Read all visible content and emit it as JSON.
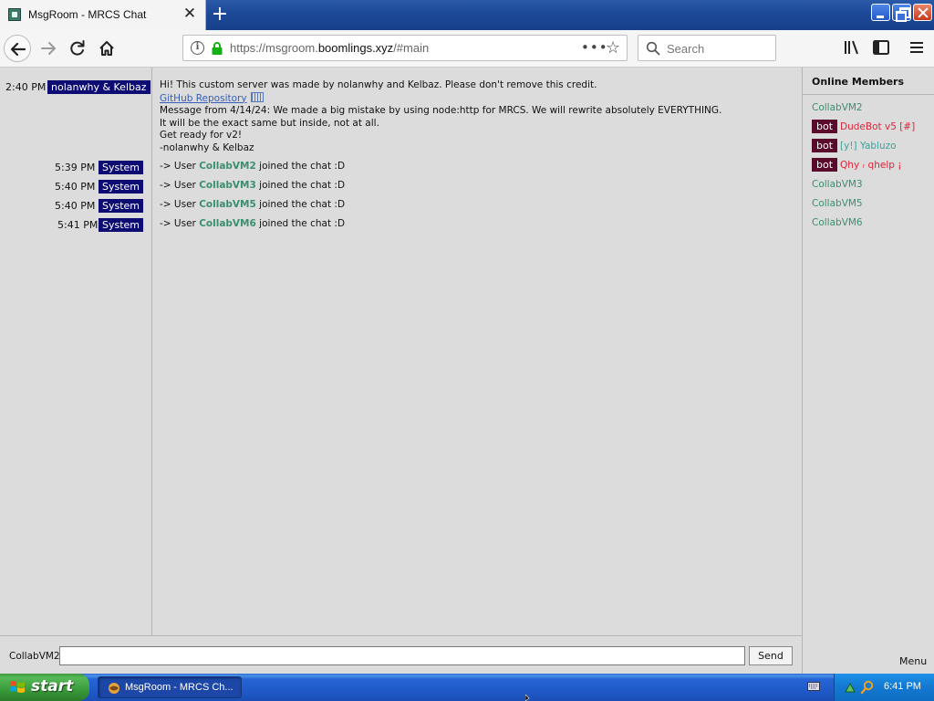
{
  "browser": {
    "tab_title": "MsgRoom - MRCS Chat",
    "tab_close_glyph": "✕",
    "new_tab_glyph": "+",
    "url_scheme_prefix": "https://msgroom.",
    "url_host": "boomlings.xyz",
    "url_path": "/#main",
    "url_more_glyph": "•••",
    "bookmark_glyph": "☆",
    "info_glyph": "i",
    "search_placeholder": "Search"
  },
  "chat": {
    "welcome": {
      "time": "2:40 PM",
      "author": "nolanwhy & Kelbaz",
      "lines": [
        "Hi! This custom server was made by nolanwhy and Kelbaz. Please don't remove this credit.",
        "GitHub Repository",
        "Message from 4/14/24: We made a big mistake by using node:http for MRCS. We will rewrite absolutely EVERYTHING.",
        "It will be the exact same but inside, not at all.",
        "Get ready for v2!",
        "-nolanwhy & Kelbaz"
      ]
    },
    "system_messages": [
      {
        "time": "5:39 PM",
        "author": "System",
        "prefix": "-> User ",
        "user": "CollabVM2",
        "suffix": " joined the chat :D"
      },
      {
        "time": "5:40 PM",
        "author": "System",
        "prefix": "-> User ",
        "user": "CollabVM3",
        "suffix": " joined the chat :D"
      },
      {
        "time": "5:40 PM",
        "author": "System",
        "prefix": "-> User ",
        "user": "CollabVM5",
        "suffix": " joined the chat :D"
      },
      {
        "time": "5:41 PM",
        "author": "System",
        "prefix": "-> User ",
        "user": "CollabVM6",
        "suffix": " joined the chat :D"
      }
    ],
    "input": {
      "username": "CollabVM2",
      "value": "",
      "send_label": "Send"
    }
  },
  "members": {
    "title": "Online Members",
    "list": [
      {
        "bot": "",
        "name": "CollabVM2",
        "color": "#3a8f6e"
      },
      {
        "bot": "bot",
        "name": "DudeBot v5 [#]",
        "color": "#e0233a"
      },
      {
        "bot": "bot",
        "name": "[y!] Yabluzo",
        "color": "#3aa39a"
      },
      {
        "bot": "bot",
        "name": "Qhy ᵣ qhelp ¡",
        "color": "#e0233a"
      },
      {
        "bot": "",
        "name": "CollabVM3",
        "color": "#3a8f6e"
      },
      {
        "bot": "",
        "name": "CollabVM5",
        "color": "#3a8f6e"
      },
      {
        "bot": "",
        "name": "CollabVM6",
        "color": "#3a8f6e"
      }
    ],
    "menu_label": "Menu"
  },
  "taskbar": {
    "start_label": "start",
    "task_label": "MsgRoom - MRCS Ch...",
    "clock": "6:41 PM"
  },
  "colors": {
    "author_badge": "#0c0c72",
    "bot_badge": "#5a0a2a",
    "member_green": "#3a8f6e",
    "member_red": "#e0233a",
    "link": "#3560b8"
  },
  "icons": {
    "back": "arrow-left-icon",
    "forward": "arrow-right-icon",
    "reload": "reload-icon",
    "home": "home-icon",
    "lock": "lock-icon",
    "library": "library-icon",
    "sidebar": "sidebar-icon",
    "menu": "hamburger-menu-icon",
    "search": "search-icon"
  }
}
